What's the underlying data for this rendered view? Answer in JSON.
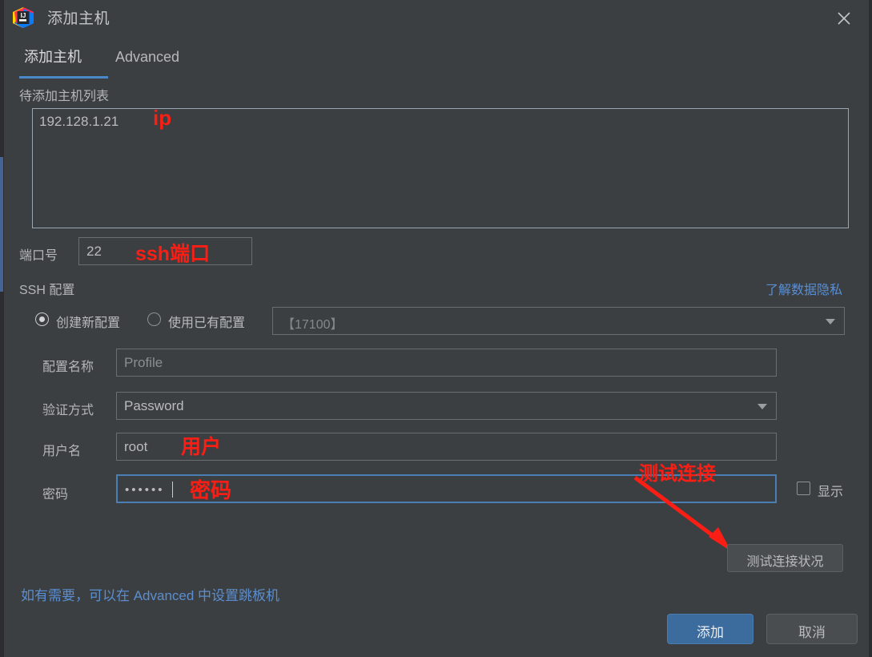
{
  "window": {
    "title": "添加主机",
    "app_icon": "intellij-idea-icon",
    "close_icon": "close-icon"
  },
  "tabs": [
    {
      "label": "添加主机",
      "active": true
    },
    {
      "label": "Advanced",
      "active": false
    }
  ],
  "host_list": {
    "label": "待添加主机列表",
    "value": "192.128.1.21",
    "annotation": "ip"
  },
  "port": {
    "label": "端口号",
    "value": "22",
    "annotation": "ssh端口"
  },
  "ssh_section": {
    "label": "SSH 配置",
    "privacy_link": "了解数据隐私"
  },
  "config_mode": {
    "new_label": "创建新配置",
    "existing_label": "使用已有配置",
    "selected": "new",
    "existing_select_value": "【17100】",
    "chevron_icon": "chevron-down-icon"
  },
  "form": {
    "profile_name": {
      "label": "配置名称",
      "value": "Profile"
    },
    "auth_method": {
      "label": "验证方式",
      "value": "Password",
      "chevron_icon": "chevron-down-icon"
    },
    "username": {
      "label": "用户名",
      "value": "root",
      "annotation": "用户"
    },
    "password": {
      "label": "密码",
      "value": "••••••",
      "annotation": "密码"
    }
  },
  "show_password": {
    "label": "显示",
    "checked": false
  },
  "test_connection": {
    "button_label": "测试连接状况",
    "annotation": "测试连接"
  },
  "hint": "如有需要，可以在 Advanced 中设置跳板机",
  "footer": {
    "confirm_label": "添加",
    "cancel_label": "取消"
  },
  "colors": {
    "dialog_bg": "#3c3f41",
    "accent_blue": "#4a88c7",
    "link_blue": "#5a8ed0",
    "primary_button": "#3c6b9e",
    "annotation_red": "#fa1e14",
    "text": "#b8babc"
  }
}
